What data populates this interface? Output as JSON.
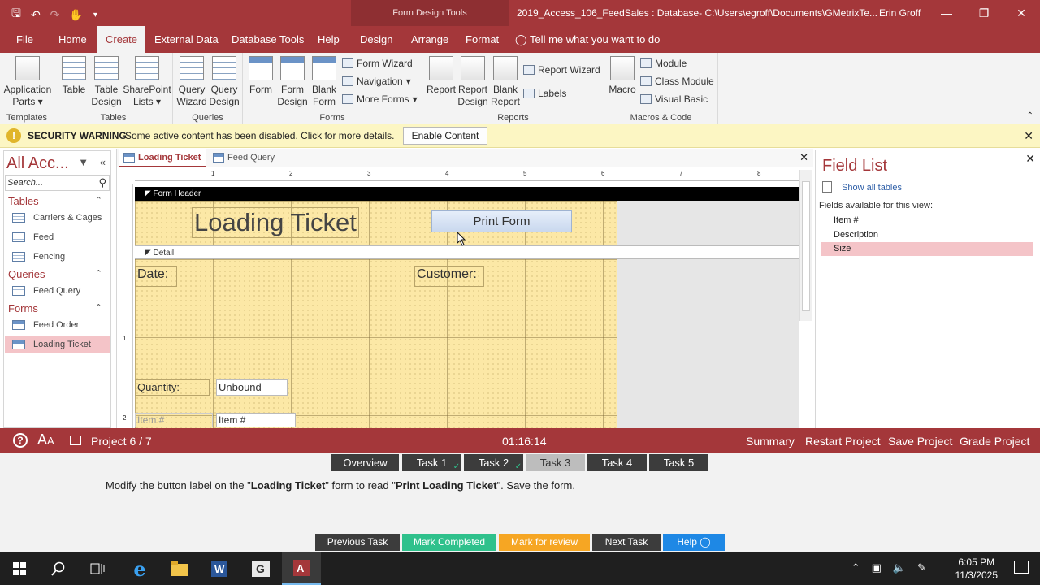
{
  "titlebar": {
    "contextual": "Form Design Tools",
    "doc_title": "2019_Access_106_FeedSales : Database- C:\\Users\\egroff\\Documents\\GMetrixTe...",
    "user": "Erin Groff"
  },
  "tabs": [
    "File",
    "Home",
    "Create",
    "External Data",
    "Database Tools",
    "Help",
    "Design",
    "Arrange",
    "Format"
  ],
  "tellme": "Tell me what you want to do",
  "ribbon": {
    "templates": {
      "label": "Templates",
      "app_parts_1": "Application",
      "app_parts_2": "Parts"
    },
    "tables": {
      "label": "Tables",
      "table": "Table",
      "table_design_1": "Table",
      "table_design_2": "Design",
      "sharepoint_1": "SharePoint",
      "sharepoint_2": "Lists"
    },
    "queries": {
      "label": "Queries",
      "wizard_1": "Query",
      "wizard_2": "Wizard",
      "design_1": "Query",
      "design_2": "Design"
    },
    "forms": {
      "label": "Forms",
      "form": "Form",
      "design_1": "Form",
      "design_2": "Design",
      "blank_1": "Blank",
      "blank_2": "Form",
      "wizard": "Form Wizard",
      "navigation": "Navigation",
      "more": "More Forms"
    },
    "reports": {
      "label": "Reports",
      "report": "Report",
      "design_1": "Report",
      "design_2": "Design",
      "blank_1": "Blank",
      "blank_2": "Report",
      "wizard": "Report Wizard",
      "labels": "Labels"
    },
    "macros": {
      "label": "Macros & Code",
      "macro": "Macro",
      "module": "Module",
      "class_module": "Class Module",
      "vb": "Visual Basic"
    }
  },
  "security": {
    "title": "SECURITY WARNING",
    "message": "Some active content has been disabled. Click for more details.",
    "button": "Enable Content"
  },
  "nav": {
    "title": "All Acc...",
    "search_placeholder": "Search...",
    "sections": [
      {
        "name": "Tables",
        "items": [
          "Carriers & Cages",
          "Feed",
          "Fencing"
        ]
      },
      {
        "name": "Queries",
        "items": [
          "Feed Query"
        ]
      },
      {
        "name": "Forms",
        "items": [
          "Feed Order",
          "Loading Ticket"
        ]
      }
    ]
  },
  "doc": {
    "tabs": [
      "Loading Ticket",
      "Feed Query"
    ],
    "ruler": [
      "1",
      "2",
      "3",
      "4",
      "5",
      "6",
      "7",
      "8"
    ],
    "vruler": [
      "1",
      "2"
    ],
    "form_header": "Form Header",
    "detail": "Detail",
    "title_label": "Loading Ticket",
    "button_label": "Print Form",
    "date_label": "Date:",
    "customer_label": "Customer:",
    "quantity_label": "Quantity:",
    "quantity_value": "Unbound",
    "item_label": "Item #",
    "item_value": "Item #"
  },
  "fieldlist": {
    "title": "Field List",
    "show_all": "Show all tables",
    "available": "Fields available for this view:",
    "fields": [
      "Item #",
      "Description",
      "Size"
    ]
  },
  "gmetrix": {
    "project": "Project 6 / 7",
    "timer": "01:16:14",
    "summary": "Summary",
    "restart": "Restart Project",
    "save": "Save Project",
    "grade": "Grade Project",
    "task_tabs": [
      "Overview",
      "Task 1",
      "Task 2",
      "Task 3",
      "Task 4",
      "Task 5"
    ],
    "task_pre": "Modify the button label on the \"",
    "task_form": "Loading Ticket",
    "task_mid": "\" form to read \"",
    "task_label": "Print Loading Ticket",
    "task_post": "\". Save the form.",
    "actions": {
      "prev": "Previous Task",
      "complete": "Mark Completed",
      "review": "Mark for review",
      "next": "Next Task",
      "help": "Help"
    }
  },
  "taskbar": {
    "time": "6:05 PM",
    "date": "11/3/2025"
  },
  "colors": {
    "accent": "#a4373a",
    "selection": "#f4c4c8",
    "complete": "#2fc18c",
    "review": "#f6a623",
    "help": "#1e88e5"
  }
}
